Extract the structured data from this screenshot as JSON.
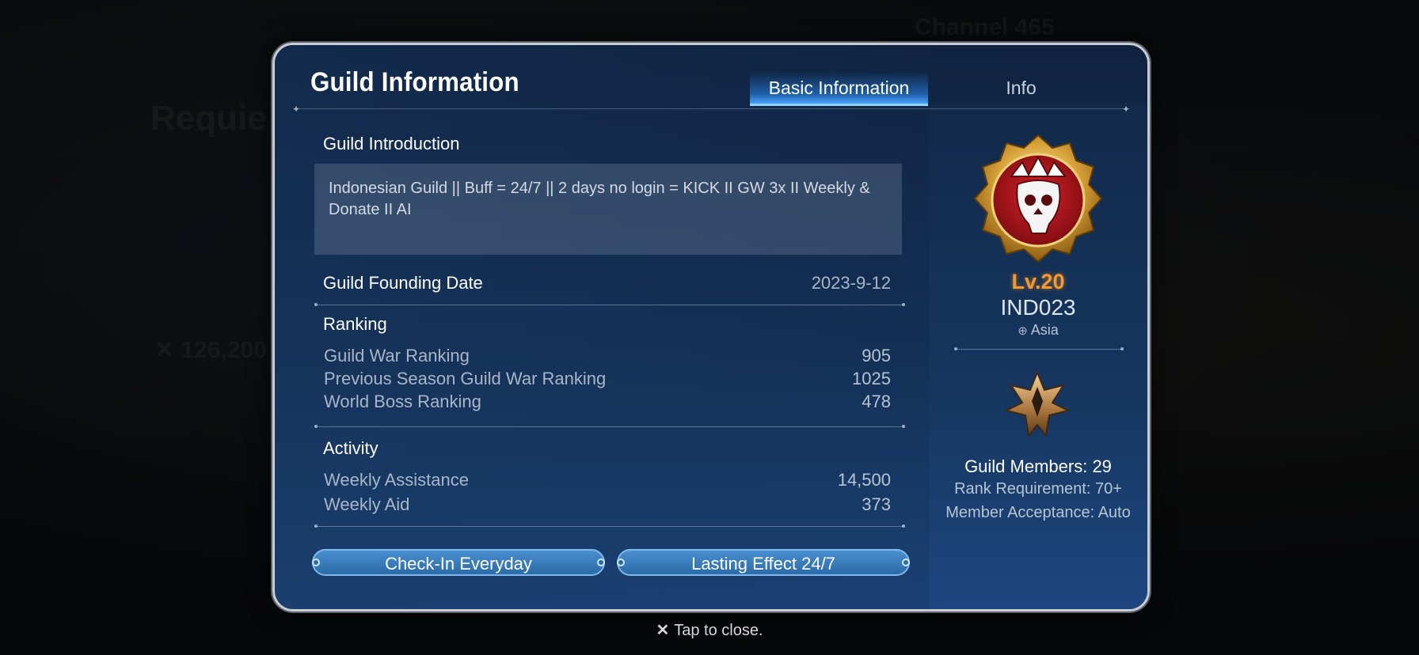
{
  "modal": {
    "title": "Guild Information",
    "tabs": [
      {
        "label": "Basic Information",
        "active": true
      },
      {
        "label": "Info",
        "active": false
      }
    ]
  },
  "introduction": {
    "label": "Guild Introduction",
    "text": "Indonesian Guild || Buff = 24/7 || 2 days no login = KICK II GW 3x II Weekly & Donate II AI"
  },
  "founding": {
    "label": "Guild Founding Date",
    "value": "2023-9-12"
  },
  "ranking": {
    "label": "Ranking",
    "rows": [
      {
        "label": "Guild War Ranking",
        "value": "905"
      },
      {
        "label": "Previous Season Guild War Ranking",
        "value": "1025"
      },
      {
        "label": "World Boss Ranking",
        "value": "478"
      }
    ]
  },
  "activity": {
    "label": "Activity",
    "rows": [
      {
        "label": "Weekly Assistance",
        "value": "14,500"
      },
      {
        "label": "Weekly Aid",
        "value": "373"
      }
    ]
  },
  "buttons": {
    "left": "Check-In Everyday",
    "right": "Lasting Effect 24/7"
  },
  "guild": {
    "level": "Lv.20",
    "name": "IND023",
    "region": "Asia",
    "members": "Guild Members: 29",
    "rank_requirement": "Rank Requirement: 70+",
    "acceptance": "Member Acceptance: Auto"
  },
  "footer": {
    "close_hint": "Tap to close."
  },
  "colors": {
    "accent": "#4aa3ff",
    "level": "#f29a2e",
    "panel": "#143057"
  }
}
